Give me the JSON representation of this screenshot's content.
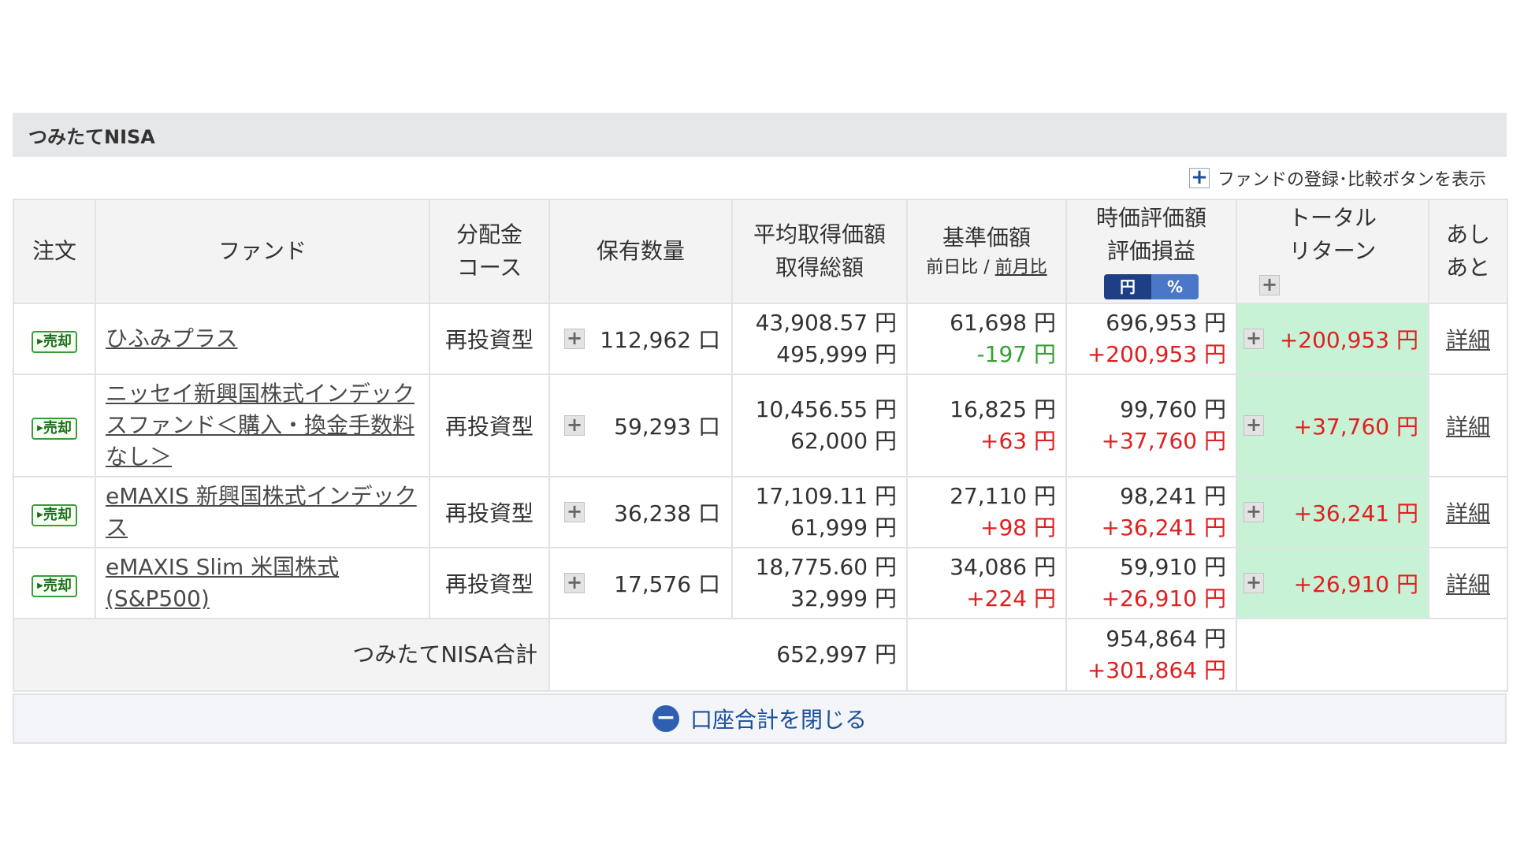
{
  "section": {
    "title": "つみたてNISA"
  },
  "fund_toggle": {
    "icon": "plus-icon",
    "label": "ファンドの登録･比較ボタンを表示"
  },
  "table": {
    "headers": {
      "order": "注文",
      "fund": "ファンド",
      "course_line1": "分配金",
      "course_line2": "コース",
      "quantity": "保有数量",
      "avg_line1": "平均取得価額",
      "avg_line2": "取得総額",
      "base_line1": "基準価額",
      "base_prev_day": "前日比",
      "base_sep": " / ",
      "base_prev_month": "前月比",
      "value_line1": "時価評価額",
      "value_line2": "評価損益",
      "toggle_yen": "円",
      "toggle_pct": "%",
      "total_line1": "トータル",
      "total_line2": "リターン",
      "ashiato_line1": "あし",
      "ashiato_line2": "あと"
    },
    "rows": [
      {
        "action": "売却",
        "fund": "ひふみプラス",
        "course": "再投資型",
        "quantity": "112,962 口",
        "avg_price": "43,908.57 円",
        "total_cost": "495,999 円",
        "base_price": "61,698 円",
        "base_change": "-197 円",
        "market_value": "696,953 円",
        "pnl": "+200,953 円",
        "total_return": "+200,953 円",
        "detail": "詳細"
      },
      {
        "action": "売却",
        "fund": "ニッセイ新興国株式インデックスファンド＜購入・換金手数料なし＞",
        "course": "再投資型",
        "quantity": "59,293 口",
        "avg_price": "10,456.55 円",
        "total_cost": "62,000 円",
        "base_price": "16,825 円",
        "base_change": "+63 円",
        "market_value": "99,760 円",
        "pnl": "+37,760 円",
        "total_return": "+37,760 円",
        "detail": "詳細"
      },
      {
        "action": "売却",
        "fund": "eMAXIS 新興国株式インデックス",
        "course": "再投資型",
        "quantity": "36,238 口",
        "avg_price": "17,109.11 円",
        "total_cost": "61,999 円",
        "base_price": "27,110 円",
        "base_change": "+98 円",
        "market_value": "98,241 円",
        "pnl": "+36,241 円",
        "total_return": "+36,241 円",
        "detail": "詳細"
      },
      {
        "action": "売却",
        "fund": "eMAXIS Slim 米国株式(S&P500)",
        "course": "再投資型",
        "quantity": "17,576 口",
        "avg_price": "18,775.60 円",
        "total_cost": "32,999 円",
        "base_price": "34,086 円",
        "base_change": "+224 円",
        "market_value": "59,910 円",
        "pnl": "+26,910 円",
        "total_return": "+26,910 円",
        "detail": "詳細"
      }
    ],
    "summary": {
      "label": "つみたてNISA合計",
      "total_cost": "652,997 円",
      "market_value": "954,864 円",
      "pnl": "+301,864 円"
    }
  },
  "close_bar": {
    "icon": "minus-circle-icon",
    "label": "口座合計を閉じる"
  },
  "colors": {
    "header_bg": "#e6e7e9",
    "total_return_bg": "#c8f2d6",
    "positive": "#e02020",
    "negative": "#35a035",
    "accent": "#1a4f9c"
  }
}
